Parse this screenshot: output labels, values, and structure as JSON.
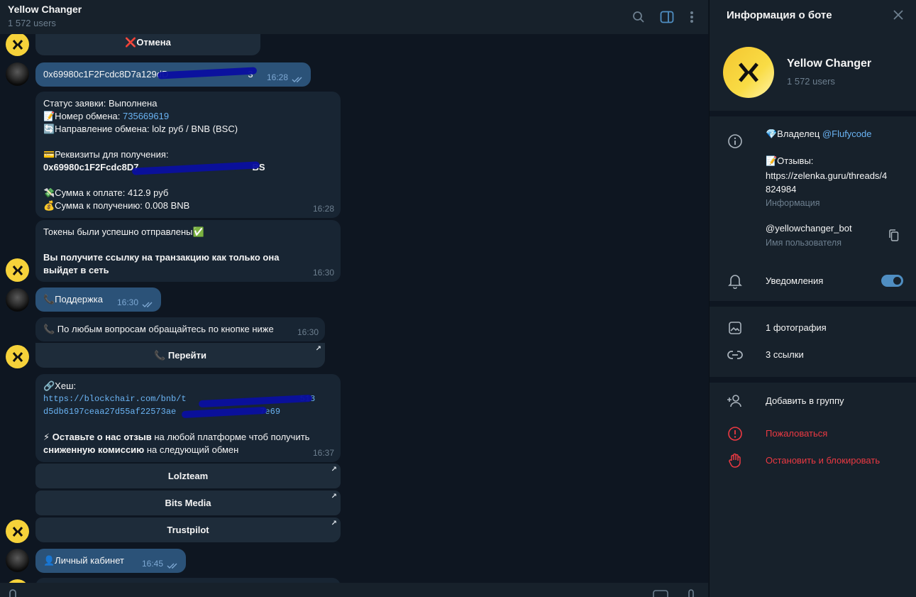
{
  "header": {
    "title": "Yellow Changer",
    "subtitle": "1 572 users"
  },
  "messages": {
    "cancel_button": "❌Отмена",
    "wallet_msg": {
      "text": "0x69980c1F2Fcdc8D7a129dD",
      "tail": "3",
      "time": "16:28"
    },
    "status_msg": {
      "line1": "Статус заявки: Выполнена",
      "line2_prefix": "📝Номер обмена: ",
      "line2_link": "735669619",
      "line3": "🔄Направление обмена: lolz руб / BNB (BSC)",
      "line4": "💳Реквизиты для получения:",
      "line5": "0x69980c1F2Fcdc8D7",
      "line5_tail": "BS",
      "line6": "💸Сумма к оплате: 412.9 руб",
      "line7": "💰Сумма к получению: 0.008 BNB",
      "time": "16:28"
    },
    "tokens_msg": {
      "line1": "Токены были успешно отправлены✅",
      "line2": "Вы получите ссылку на транзакцию как только она выйдет в сеть",
      "time": "16:30"
    },
    "support_out": {
      "text": "📞Поддержка",
      "time": "16:30"
    },
    "support_in": {
      "text": "📞 По любым вопросам обращайтесь по кнопке ниже",
      "time": "16:30"
    },
    "go_button": "📞 Перейти",
    "hash_msg": {
      "line1": "🔗Хеш:",
      "line2": "https://blockchair.com/bnb/t",
      "line2_tail": "518",
      "line3": "d5db6197ceaa27d55af22573ae",
      "line3_tail": "7e69",
      "line4_prefix": "⚡ ",
      "line4_bold": "Оставьте о нас отзыв",
      "line4_rest": " на любой платформе чтоб получить",
      "line5_bold": "сниженную комиссию",
      "line5_rest": " на следующий обмен",
      "time": "16:37"
    },
    "review_buttons": [
      "Lolzteam",
      "Bits Media",
      "Trustpilot"
    ],
    "cabinet_out": {
      "text": "👤Личный кабинет",
      "time": "16:45"
    }
  },
  "panel": {
    "title": "Информация о боте",
    "bot_name": "Yellow Changer",
    "bot_users": "1 572 users",
    "owner_prefix": "💎Владелец ",
    "owner_link": "@Flufycode",
    "reviews_label": "📝Отзывы:",
    "reviews_link_1": "https://zelenka.guru/threads/4",
    "reviews_link_2": "824984",
    "info_label": "Информация",
    "username": "@yellowchanger_bot",
    "username_label": "Имя пользователя",
    "notifications": "Уведомления",
    "notifications_on": true,
    "photos": "1 фотография",
    "links": "3 ссылки",
    "add_to_group": "Добавить в группу",
    "report": "Пожаловаться",
    "stop_block": "Остановить и блокировать"
  },
  "colors": {
    "background": "#0e1621",
    "panel": "#17212b",
    "bubble_in": "#182533",
    "bubble_out": "#2b5278",
    "link": "#6ab3f3",
    "danger": "#ec3942",
    "bot_avatar": "#f6d23a"
  },
  "icons": [
    "search-icon",
    "sidebar-toggle-icon",
    "more-vertical-icon",
    "close-icon",
    "info-icon",
    "copy-icon",
    "bell-icon",
    "photo-icon",
    "link-icon",
    "add-user-icon",
    "report-icon",
    "hand-stop-icon",
    "double-check-icon",
    "external-arrow-icon",
    "attach-icon",
    "bot-command-icon",
    "mic-icon"
  ]
}
